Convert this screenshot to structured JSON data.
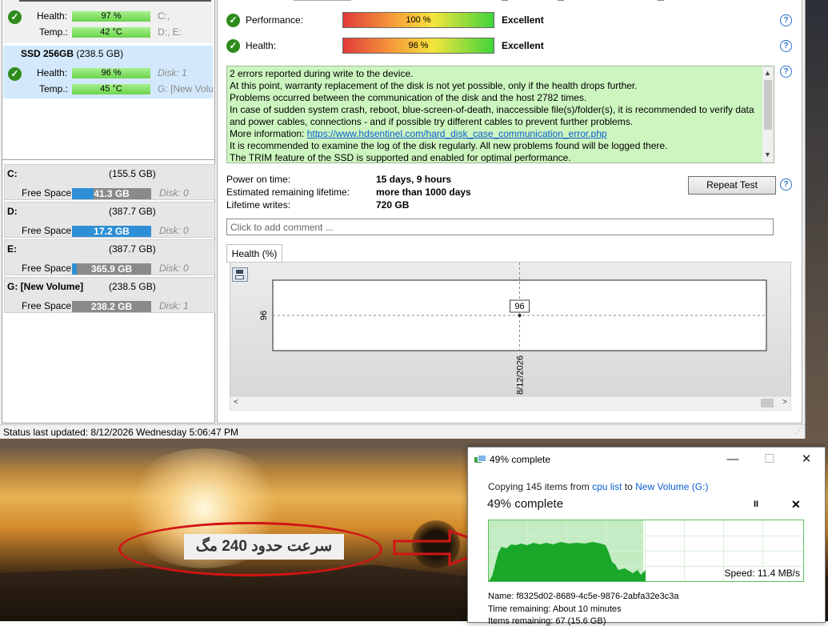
{
  "top_disk": {
    "health_label": "Health:",
    "health_value": "97 %",
    "health_partitions": "C:,",
    "temp_label": "Temp.:",
    "temp_value": "42 °C",
    "temp_partitions": "D:, E:"
  },
  "selected_disk": {
    "name": "SSD 256GB",
    "size": "(238.5 GB)",
    "health_label": "Health:",
    "health_value": "96 %",
    "disk_label": "Disk: 1",
    "temp_label": "Temp.:",
    "temp_value": "45 °C",
    "partition_label": "G: [New Volu"
  },
  "partitions": [
    {
      "letter": "C:",
      "size": "(155.5 GB)",
      "free_label": "Free Space",
      "free_value": "41.3 GB",
      "free_fraction": 0.27,
      "disk": "Disk: 0",
      "fill_color": "#2f8fd6"
    },
    {
      "letter": "D:",
      "size": "(387.7 GB)",
      "free_label": "Free Space",
      "free_value": "17.2 GB",
      "free_fraction": 1.0,
      "disk": "Disk: 0",
      "fill_color": "#2f8fd6"
    },
    {
      "letter": "E:",
      "size": "(387.7 GB)",
      "free_label": "Free Space",
      "free_value": "365.9 GB",
      "free_fraction": 0.06,
      "disk": "Disk: 0",
      "fill_color": "#2f8fd6"
    },
    {
      "letter": "G: [New Volume]",
      "size": "(238.5 GB)",
      "free_label": "Free Space",
      "free_value": "238.2 GB",
      "free_fraction": 0.0,
      "disk": "Disk: 1",
      "fill_color": "#2f8fd6"
    }
  ],
  "right": {
    "performance_label": "Performance:",
    "performance_value": "100 %",
    "performance_rating": "Excellent",
    "health_label": "Health:",
    "health_value": "96 %",
    "health_rating": "Excellent",
    "messages": [
      "2 errors reported during write to the device.",
      "At this point, warranty replacement of the disk is not yet possible, only if the health drops further.",
      "Problems occurred between the communication of the disk and the host 2782 times.",
      "In case of sudden system crash, reboot, blue-screen-of-death, inaccessible file(s)/folder(s), it is recommended to verify data and power cables, connections - and if possible try different cables to prevent further problems.",
      "More information: ",
      "It is recommended to examine the log of the disk regularly. All new problems found will be logged there.",
      "The TRIM feature of the SSD is supported and enabled for optimal performance."
    ],
    "more_info_link": "https://www.hdsentinel.com/hard_disk_case_communication_error.php",
    "power_on_label": "Power on time:",
    "power_on_value": "15 days, 9 hours",
    "lifetime_label": "Estimated remaining lifetime:",
    "lifetime_value": "more than 1000 days",
    "writes_label": "Lifetime writes:",
    "writes_value": "720 GB",
    "repeat_button": "Repeat Test",
    "comment_placeholder": "Click to add comment ...",
    "chart_tab": "Health (%)",
    "help_glyph": "?"
  },
  "chart_data": {
    "type": "line",
    "x": [
      "8/12/2026"
    ],
    "series": [
      {
        "values": [
          96
        ]
      }
    ],
    "ytick": "96",
    "point_label": "96"
  },
  "status": {
    "text": "Status last updated: 8/12/2026 Wednesday 5:06:47 PM"
  },
  "copy_dialog": {
    "title": "49% complete",
    "copying_prefix": "Copying 145 items from ",
    "source": "cpu list",
    "to_word": " to ",
    "destination": "New Volume (G:)",
    "heading": "49% complete",
    "progress_fraction": 0.49,
    "speed": "Speed: 11.4 MB/s",
    "name_label": "Name:",
    "name_value": "f8325d02-8689-4c5e-9876-2abfa32e3c3a",
    "time_label": "Time remaining:",
    "time_value": "About 10 minutes",
    "items_label": "Items remaining:",
    "items_value": "67 (15.6 GB)",
    "pause_glyph": "II",
    "cancel_glyph": "✕",
    "minimize_glyph": "—",
    "maximize_glyph": "☐",
    "close_glyph": "✕"
  },
  "annotation": {
    "text": "سرعت حدود 240 مگ"
  }
}
